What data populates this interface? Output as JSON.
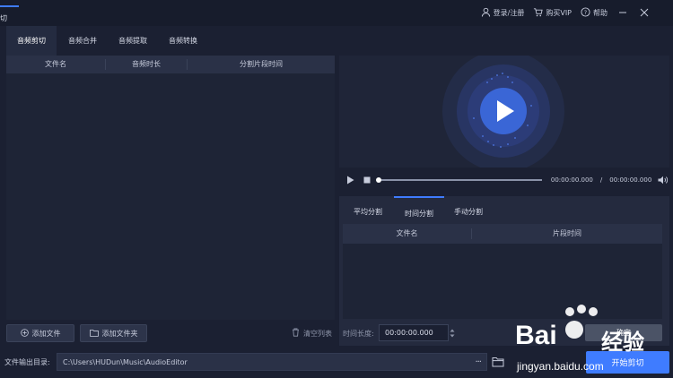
{
  "app": {
    "title": "切"
  },
  "topbar": {
    "login_label": "登录/注册",
    "vip_label": "购买VIP",
    "help_label": "帮助"
  },
  "tabs": [
    "音频剪切",
    "音频合并",
    "音频提取",
    "音频转换"
  ],
  "file_list": {
    "columns": [
      "文件名",
      "音频时长",
      "分割片段时间"
    ]
  },
  "buttons": {
    "add_file": "添加文件",
    "add_folder": "添加文件夹",
    "clear_list": "清空列表",
    "start_cut": "开始剪切",
    "confirm": "确定"
  },
  "output": {
    "label": "文件输出目录:",
    "path": "C:\\Users\\HUDun\\Music\\AudioEditor",
    "more": "···"
  },
  "player": {
    "current_time": "00:00:00.000",
    "separator": "/",
    "total_time": "00:00:00.000",
    "progress": 0
  },
  "split": {
    "tabs": [
      "平均分割",
      "时间分割",
      "手动分割"
    ],
    "active_tab_index": 1,
    "columns": [
      "文件名",
      "片段时间"
    ],
    "duration_label": "时间长度:",
    "duration_value": "00:00:00.000"
  },
  "watermark": {
    "brand": "Bai",
    "brand2": "经验",
    "url": "jingyan.baidu.com"
  },
  "colors": {
    "accent": "#3f7cff",
    "background": "#1b2032",
    "panel": "#242a3e"
  }
}
